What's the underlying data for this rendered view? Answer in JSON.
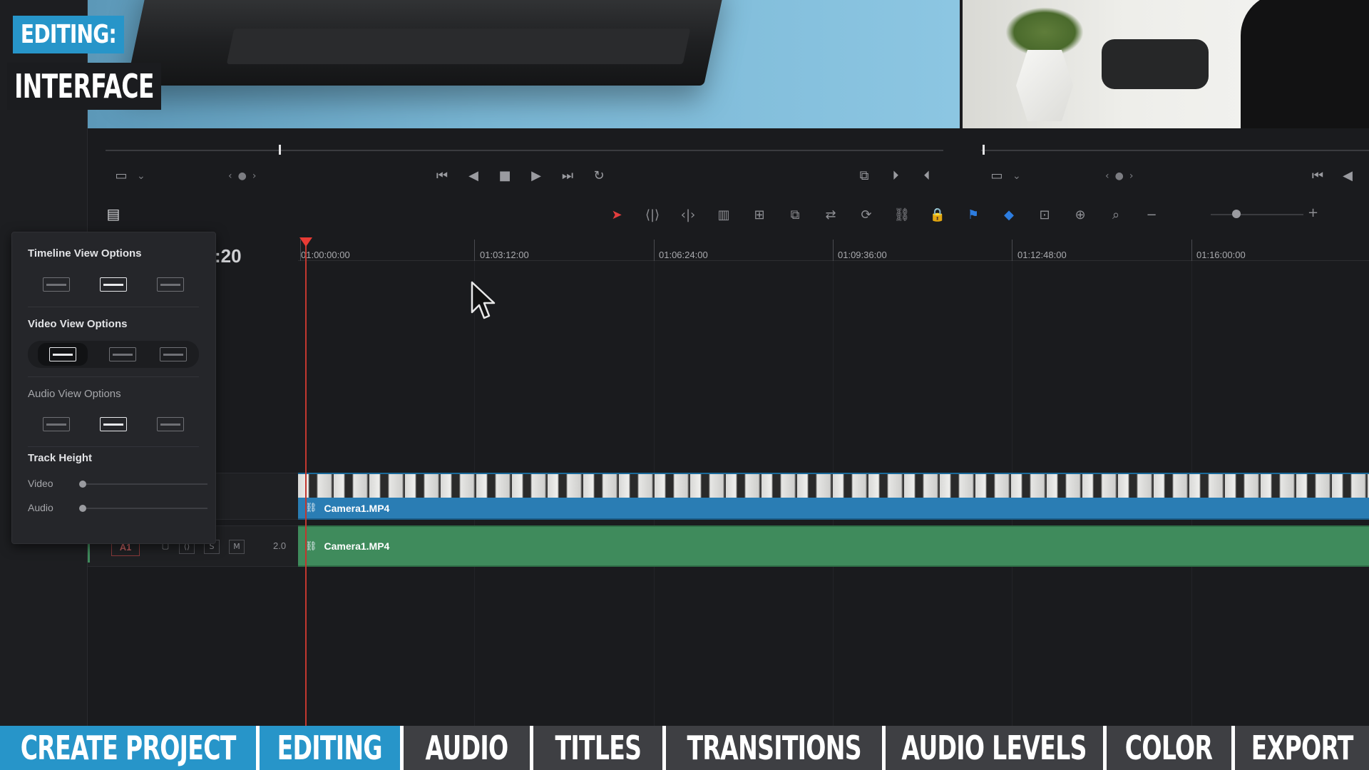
{
  "overlay": {
    "badge_top": "EDITING:",
    "badge_bottom": "INTERFACE"
  },
  "ruler": {
    "current_tc_partial": ":20",
    "timecodes": [
      "01:00:00:00",
      "01:03:12:00",
      "01:06:24:00",
      "01:09:36:00",
      "01:12:48:00",
      "01:16:00:00"
    ]
  },
  "popup": {
    "timeline_view_title": "Timeline View Options",
    "video_view_title": "Video View Options",
    "audio_view_title": "Audio View Options",
    "track_height_title": "Track Height",
    "video_label": "Video",
    "audio_label": "Audio"
  },
  "tracks": {
    "video_clip_name": "Camera1.MP4",
    "audio_clip_name": "Camera1.MP4",
    "audio_track_id": "A1",
    "audio_solo": "S",
    "audio_mute": "M",
    "audio_channels": "2.0"
  },
  "bottom_nav": {
    "items": [
      "CREATE PROJECT",
      "EDITING",
      "AUDIO",
      "TITLES",
      "TRANSITIONS",
      "AUDIO LEVELS",
      "COLOR",
      "EXPORT"
    ],
    "active": "EDITING"
  },
  "colors": {
    "accent_blue": "#2795c9",
    "playhead_red": "#e83b35",
    "video_clip": "#2a7db4",
    "audio_clip": "#3f8b5c"
  }
}
